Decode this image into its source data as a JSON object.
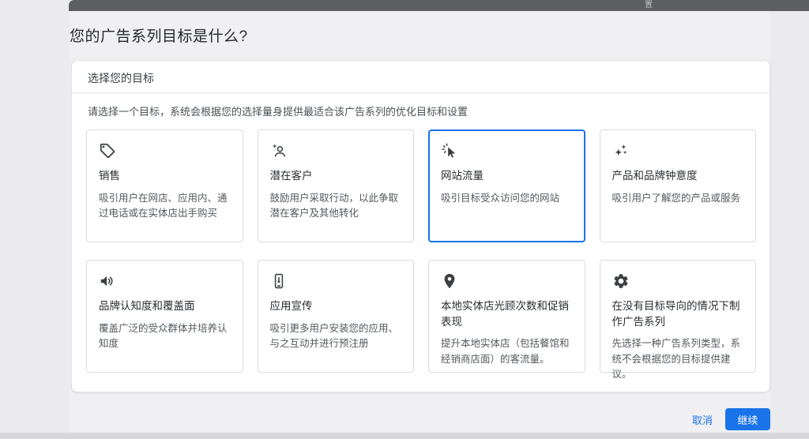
{
  "top_bar": {
    "partial_text": "置"
  },
  "page": {
    "title": "您的广告系列目标是什么?",
    "card": {
      "header": "选择您的目标",
      "instruction": "请选择一个目标，系统会根据您的选择量身提供最适合该广告系列的优化目标和设置",
      "goals": [
        {
          "icon": "sell-tag-icon",
          "title": "销售",
          "description": "吸引用户在网店、应用内、通过电话或在实体店出手购买",
          "selected": false
        },
        {
          "icon": "leads-person-icon",
          "title": "潜在客户",
          "description": "鼓励用户采取行动，以此争取潜在客户及其他转化",
          "selected": false
        },
        {
          "icon": "website-traffic-cursor-icon",
          "title": "网站流量",
          "description": "吸引目标受众访问您的网站",
          "selected": true
        },
        {
          "icon": "sparkles-icon",
          "title": "产品和品牌钟意度",
          "description": "吸引用户了解您的产品或服务",
          "selected": false
        },
        {
          "icon": "speaker-icon",
          "title": "品牌认知度和覆盖面",
          "description": "覆盖广泛的受众群体并培养认知度",
          "selected": false
        },
        {
          "icon": "app-phone-icon",
          "title": "应用宣传",
          "description": "吸引更多用户安装您的应用、与之互动并进行预注册",
          "selected": false
        },
        {
          "icon": "location-pin-icon",
          "title": "本地实体店光顾次数和促销表现",
          "description": "提升本地实体店（包括餐馆和经销商店面）的客流量。",
          "selected": false
        },
        {
          "icon": "gear-icon",
          "title": "在没有目标导向的情况下制作广告系列",
          "description": "先选择一种广告系列类型，系统不会根据您的目标提供建议。",
          "selected": false
        }
      ]
    },
    "footer": {
      "cancel_label": "取消",
      "continue_label": "继续"
    }
  },
  "colors": {
    "accent_blue": "#1a73e8",
    "selected_border": "#1a73e8",
    "top_bar_gray": "#5d5e61",
    "page_background": "#ebebee",
    "card_background": "#ffffff"
  }
}
